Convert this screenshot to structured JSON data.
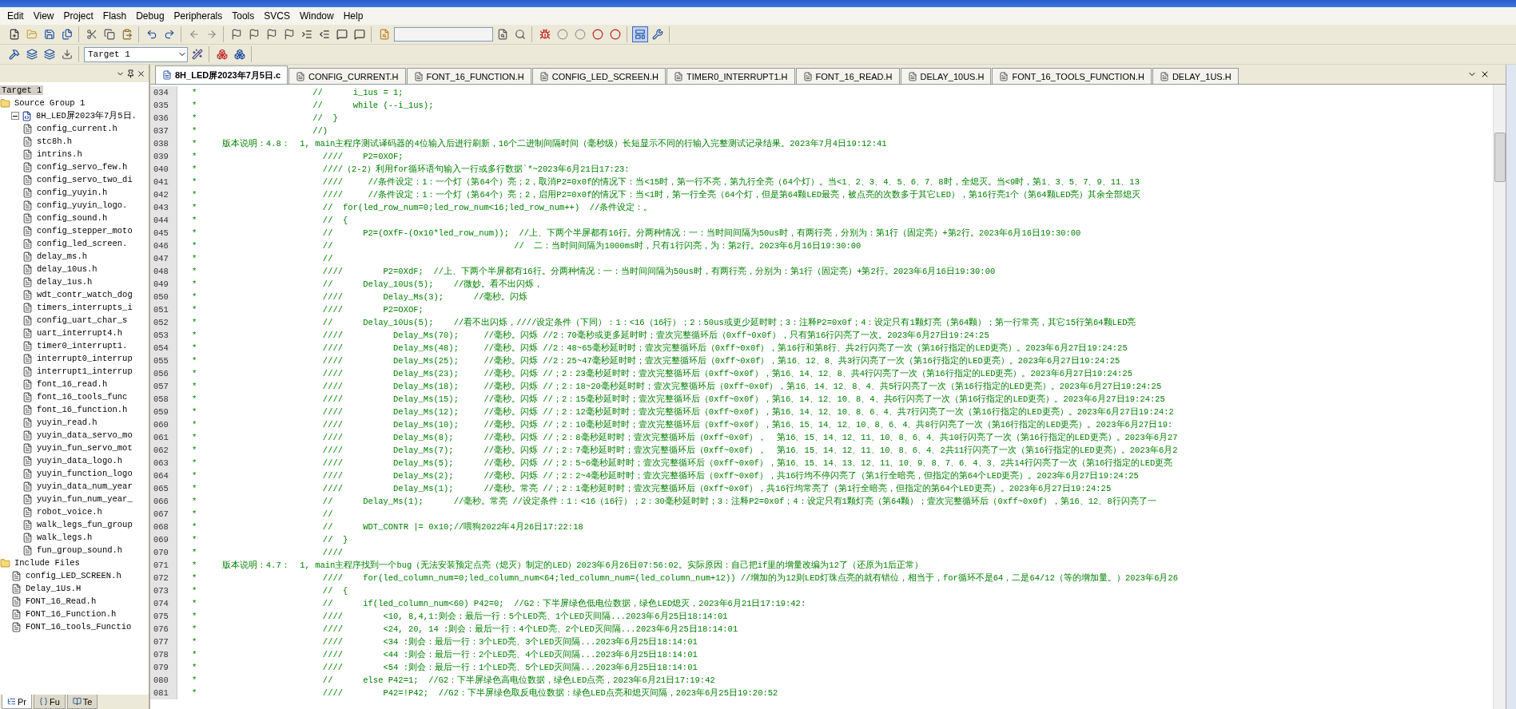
{
  "menu": [
    "Edit",
    "View",
    "Project",
    "Flash",
    "Debug",
    "Peripherals",
    "Tools",
    "SVCS",
    "Window",
    "Help"
  ],
  "toolbar": {
    "window_toggle_selected": true,
    "target_select": "Target 1"
  },
  "project_panel": {
    "tree": [
      {
        "label": "Target 1",
        "kind": "target",
        "selected": true,
        "children": [
          {
            "label": "Source Group 1",
            "kind": "folder",
            "selected": false,
            "children": [
              {
                "label": "8H_LED屏2023年7月5日.",
                "kind": "source",
                "selected": false,
                "expanded": true,
                "children": [
                  {
                    "label": "config_current.h",
                    "kind": "header",
                    "selected": false
                  },
                  {
                    "label": "stc8h.h",
                    "kind": "header",
                    "selected": false
                  },
                  {
                    "label": "intrins.h",
                    "kind": "header",
                    "selected": false
                  },
                  {
                    "label": "config_servo_few.h",
                    "kind": "header",
                    "selected": false
                  },
                  {
                    "label": "config_servo_two_di",
                    "kind": "header",
                    "selected": false
                  },
                  {
                    "label": "config_yuyin.h",
                    "kind": "header",
                    "selected": false
                  },
                  {
                    "label": "config_yuyin_logo.",
                    "kind": "header",
                    "selected": false
                  },
                  {
                    "label": "config_sound.h",
                    "kind": "header",
                    "selected": false
                  },
                  {
                    "label": "config_stepper_moto",
                    "kind": "header",
                    "selected": false
                  },
                  {
                    "label": "config_led_screen.",
                    "kind": "header",
                    "selected": false
                  },
                  {
                    "label": "delay_ms.h",
                    "kind": "header",
                    "selected": false
                  },
                  {
                    "label": "delay_10us.h",
                    "kind": "header",
                    "selected": false
                  },
                  {
                    "label": "delay_1us.h",
                    "kind": "header",
                    "selected": false
                  },
                  {
                    "label": "wdt_contr_watch_dog",
                    "kind": "header",
                    "selected": false
                  },
                  {
                    "label": "timers_interrupts_i",
                    "kind": "header",
                    "selected": false
                  },
                  {
                    "label": "config_uart_char_s",
                    "kind": "header",
                    "selected": false
                  },
                  {
                    "label": "uart_interrupt4.h",
                    "kind": "header",
                    "selected": false
                  },
                  {
                    "label": "timer0_interrupt1.",
                    "kind": "header",
                    "selected": false
                  },
                  {
                    "label": "interrupt0_interrup",
                    "kind": "header",
                    "selected": false
                  },
                  {
                    "label": "interrupt1_interrup",
                    "kind": "header",
                    "selected": false
                  },
                  {
                    "label": "font_16_read.h",
                    "kind": "header",
                    "selected": false
                  },
                  {
                    "label": "font_16_tools_func",
                    "kind": "header",
                    "selected": false
                  },
                  {
                    "label": "font_16_function.h",
                    "kind": "header",
                    "selected": false
                  },
                  {
                    "label": "yuyin_read.h",
                    "kind": "header",
                    "selected": false
                  },
                  {
                    "label": "yuyin_data_servo_mo",
                    "kind": "header",
                    "selected": false
                  },
                  {
                    "label": "yuyin_fun_servo_mot",
                    "kind": "header",
                    "selected": false
                  },
                  {
                    "label": "yuyin_data_logo.h",
                    "kind": "header",
                    "selected": false
                  },
                  {
                    "label": "yuyin_function_logo",
                    "kind": "header",
                    "selected": false
                  },
                  {
                    "label": "yuyin_data_num_year",
                    "kind": "header",
                    "selected": false
                  },
                  {
                    "label": "yuyin_fun_num_year_",
                    "kind": "header",
                    "selected": false
                  },
                  {
                    "label": "robot_voice.h",
                    "kind": "header",
                    "selected": false
                  },
                  {
                    "label": "walk_legs_fun_group",
                    "kind": "header",
                    "selected": false
                  },
                  {
                    "label": "walk_legs.h",
                    "kind": "header",
                    "selected": false
                  },
                  {
                    "label": "fun_group_sound.h",
                    "kind": "header",
                    "selected": false
                  }
                ]
              }
            ]
          },
          {
            "label": "Include Files",
            "kind": "folder",
            "selected": false,
            "children": [
              {
                "label": "config_LED_SCREEN.h",
                "kind": "header",
                "selected": false
              },
              {
                "label": "Delay_1Us.H",
                "kind": "header",
                "selected": false
              },
              {
                "label": "FONT_16_Read.h",
                "kind": "header",
                "selected": false
              },
              {
                "label": "FONT_16_Function.h",
                "kind": "header",
                "selected": false
              },
              {
                "label": "FONT_16_tools_Functio",
                "kind": "header",
                "selected": false
              }
            ]
          }
        ]
      }
    ],
    "bottom_tabs": [
      {
        "label": "Pr",
        "selected": true
      },
      {
        "label": "Fu",
        "selected": false
      },
      {
        "label": "Te",
        "selected": false
      }
    ]
  },
  "editor": {
    "tabs": [
      {
        "label": "8H_LED屏2023年7月5日.c",
        "selected": true
      },
      {
        "label": "CONFIG_CURRENT.H",
        "selected": false
      },
      {
        "label": "FONT_16_FUNCTION.H",
        "selected": false
      },
      {
        "label": "CONFIG_LED_SCREEN.H",
        "selected": false
      },
      {
        "label": "TIMER0_INTERRUPT1.H",
        "selected": false
      },
      {
        "label": "FONT_16_READ.H",
        "selected": false
      },
      {
        "label": "DELAY_10US.H",
        "selected": false
      },
      {
        "label": "FONT_16_TOOLS_FUNCTION.H",
        "selected": false
      },
      {
        "label": "DELAY_1US.H",
        "selected": false
      }
    ],
    "lines": [
      {
        "number": "034",
        "text": "*                       //      i_1us = 1;"
      },
      {
        "number": "035",
        "text": "*                       //      while (--i_1us);"
      },
      {
        "number": "036",
        "text": "*                       //  }"
      },
      {
        "number": "037",
        "text": "*                       //)"
      },
      {
        "number": "038",
        "text": "*     版本说明：4.8：  1, main主程序测试译码器的4位输入后进行刷新，16个二进制间隔时间（毫秒级）长短显示不同的行输入完整测试记录结果。2023年7月4日19:12:41"
      },
      {
        "number": "039",
        "text": "*                         ////    P2=0XOF;"
      },
      {
        "number": "040",
        "text": "*                         ////（2-2）利用for循环语句输入一行或多行数据`*~2023年6月21日17:23:"
      },
      {
        "number": "041",
        "text": "*                         ////     //条件设定：1：一个灯（第64个）亮；2，取消P2=0x0f的情况下：当<15时，第一行不亮，第九行全亮（64个灯）。当<1、2、3、4、5、6、7、8时，全熄灭。当<9时，第1、3、5、7、9、11、13"
      },
      {
        "number": "042",
        "text": "*                         ////     //条件设定：1：一个灯（第64个）亮；2，启用P2=0x0f的情况下：当<1时，第一行全亮（64个灯，但是第64颗LED最亮，被点亮的次数多于其它LED），第16行亮1个（第64颗LED亮）其余全部熄灭"
      },
      {
        "number": "043",
        "text": "*                         //  for(led_row_num=0;led_row_num<16;led_row_num++)  //条件设定：。"
      },
      {
        "number": "044",
        "text": "*                         //  {"
      },
      {
        "number": "045",
        "text": "*                         //      P2=(OXfF-(Ox10*led_row_num));  //上、下两个半屏都有16行。分两种情况：一：当时间间隔为50us时，有两行亮，分别为：第1行（固定亮）+第2行。2023年6月16日19:30:00"
      },
      {
        "number": "046",
        "text": "*                         //                                    //  二：当时间间隔为1000ms时，只有1行闪亮，为：第2行。2023年6月16日19:30:00"
      },
      {
        "number": "047",
        "text": "*                         //"
      },
      {
        "number": "048",
        "text": "*                         ////        P2=0XdF;  //上、下两个半屏都有16行。分两种情况：一：当时间间隔为50us时，有两行亮，分别为：第1行（固定亮）+第2行。2023年6月16日19:30:00"
      },
      {
        "number": "049",
        "text": "*                         //      Delay_10Us(5);    //微妙。看不出闪烁，"
      },
      {
        "number": "050",
        "text": "*                         ////        Delay_Ms(3);      //毫秒。闪烁"
      },
      {
        "number": "051",
        "text": "*                         ////        P2=OXOF;"
      },
      {
        "number": "052",
        "text": "*                         //      Delay_10Us(5);    //看不出闪烁，////设定条件（下同）：1：<16（16行）；2：50us或更少延时时；3：注释P2=0x0f；4：设定只有1颗灯亮（第64颗）；第一行常亮，其它15行第64颗LED亮"
      },
      {
        "number": "053",
        "text": "*                         ////          Delay_Ms(70);     //毫秒。闪烁 //2：70毫秒或更多延时时；壹次完整循环后（0xff~0x0f），只有第16行闪亮了一次。2023年6月27日19:24:25"
      },
      {
        "number": "054",
        "text": "*                         ////          Delay_Ms(48);     //毫秒。闪烁 //2：48~65毫秒延时时；壹次完整循环后（0xff~0x0f），第16行和第8行、共2行闪亮了一次（第16行指定的LED更亮）。2023年6月27日19:24:25"
      },
      {
        "number": "055",
        "text": "*                         ////          Delay_Ms(25);     //毫秒。闪烁 //2：25~47毫秒延时时；壹次完整循环后（0xff~0x0f），第16、12、8、共3行闪亮了一次（第16行指定的LED更亮）。2023年6月27日19:24:25"
      },
      {
        "number": "056",
        "text": "*                         ////          Delay_Ms(23);     //毫秒。闪烁 //；2：23毫秒延时时；壹次完整循环后（0xff~0x0f），第16、14、12、8、共4行闪亮了一次（第16行指定的LED更亮）。2023年6月27日19:24:25"
      },
      {
        "number": "057",
        "text": "*                         ////          Delay_Ms(18);     //毫秒。闪烁 //；2：18~20毫秒延时时；壹次完整循环后（0xff~0x0f），第16、14、12、8、4、共5行闪亮了一次（第16行指定的LED更亮）。2023年6月27日19:24:25"
      },
      {
        "number": "058",
        "text": "*                         ////          Delay_Ms(15);     //毫秒。闪烁 //；2：15毫秒延时时；壹次完整循环后（0xff~0x0f），第16、14、12、10、8、4、共6行闪亮了一次（第16行指定的LED更亮）。2023年6月27日19:24:25"
      },
      {
        "number": "059",
        "text": "*                         ////          Delay_Ms(12);     //毫秒。闪烁 //；2：12毫秒延时时；壹次完整循环后（0xff~0x0f），第16、14、12、10、8、6、4、共7行闪亮了一次（第16行指定的LED更亮）。2023年6月27日19:24:2"
      },
      {
        "number": "060",
        "text": "*                         ////          Delay_Ms(10);     //毫秒。闪烁 //；2：10毫秒延时时；壹次完整循环后（0xff~0x0f），第16、15、14、12、10、8、6、4、共8行闪亮了一次（第16行指定的LED更亮）。2023年6月27日19:"
      },
      {
        "number": "061",
        "text": "*                         ////          Delay_Ms(8);      //毫秒。闪烁 //；2：8毫秒延时时；壹次完整循环后（0xff~0x0f），  第16、15、14、12、11、10、8、6、4、共10行闪亮了一次（第16行指定的LED更亮）。2023年6月27"
      },
      {
        "number": "062",
        "text": "*                         ////          Delay_Ms(7);      //毫秒。闪烁 //；2：7毫秒延时时；壹次完整循环后（0xff~0x0f），  第16、15、14、12、11、10、8、6、4、2共11行闪亮了一次（第16行指定的LED更亮）。2023年6月2"
      },
      {
        "number": "063",
        "text": "*                         ////          Delay_Ms(5);      //毫秒。闪烁 //；2：5~6毫秒延时时；壹次完整循环后（0xff~0x0f），第16、15、14、13、12、11、10、9、8、7、6、4、3、2共14行闪亮了一次（第16行指定的LED更亮"
      },
      {
        "number": "064",
        "text": "*                         ////          Delay_Ms(2);      //毫秒。闪烁 //；2：2~4毫秒延时时；壹次完整循环后（0xff~0x0f），共16行均不停闪亮了（第1行全暗亮，但指定的第64个LED更亮）。2023年6月27日19:24:25"
      },
      {
        "number": "065",
        "text": "*                         ////          Delay_Ms(1);      //毫秒。常亮 //；2：1毫秒延时时；壹次完整循环后（0xff~0x0f），共16行均常亮了（第1行全暗亮，但指定的第64个LED更亮）。2023年6月27日19:24:25"
      },
      {
        "number": "066",
        "text": "*                         //      Delay_Ms(1);      //毫秒。常亮 //设定条件：1：<16（16行）；2：30毫秒延时时；3：注释P2=0x0f；4：设定只有1颗灯亮（第64颗）；壹次完整循环后（0xff~0x0f），第16、12、8行闪亮了一"
      },
      {
        "number": "067",
        "text": "*                         //"
      },
      {
        "number": "068",
        "text": "*                         //      WDT_CONTR |= 0x10;//喂狗2022年4月26日17:22:18"
      },
      {
        "number": "069",
        "text": "*                         //  }"
      },
      {
        "number": "070",
        "text": "*                         ////"
      },
      {
        "number": "071",
        "text": "*     版本说明：4.7：  1, main主程序找到一个bug（无法安装预定点亮（熄灭）制定的LED）2023年6月26日07:56:02。实际原因：自己把if里的增量改编为12了（还原为1后正常）"
      },
      {
        "number": "072",
        "text": "*                         ////    for(led_column_num=0;led_column_num<64;led_column_num=(led_column_num+12)) //增加的为12则LED灯珠点亮的就有错位，相当于，for循环不是64，二是64/12（等的增加量。）2023年6月26"
      },
      {
        "number": "073",
        "text": "*                         //  {"
      },
      {
        "number": "074",
        "text": "*                         //      if(led_column_num<60) P42=0;  //G2：下半屏绿色低电位数据，绿色LED熄灭，2023年6月21日17:19:42:"
      },
      {
        "number": "075",
        "text": "*                         ////        <10, 8,4,1:则会：最后一行：5个LED亮、1个LED灭间隔...2023年6月25日18:14:01"
      },
      {
        "number": "076",
        "text": "*                         ////        <24, 20, 14 :则会：最后一行：4个LED亮、2个LED灭间隔...2023年6月25日18:14:01"
      },
      {
        "number": "077",
        "text": "*                         ////        <34 :则会：最后一行：3个LED亮、3个LED灭间隔...2023年6月25日18:14:01"
      },
      {
        "number": "078",
        "text": "*                         ////        <44 :则会：最后一行：2个LED亮、4个LED灭间隔...2023年6月25日18:14:01"
      },
      {
        "number": "079",
        "text": "*                         ////        <54 :则会：最后一行：1个LED亮、5个LED灭间隔...2023年6月25日18:14:01"
      },
      {
        "number": "080",
        "text": "*                         //      else P42=1;  //G2：下半屏绿色高电位数据，绿色LED点亮，2023年6月21日17:19:42"
      },
      {
        "number": "081",
        "text": "*                         ////        P42=!P42;  //G2：下半屏绿色取反电位数据：绿色LED点亮和熄灭间隔，2023年6月25日19:20:52"
      }
    ]
  }
}
